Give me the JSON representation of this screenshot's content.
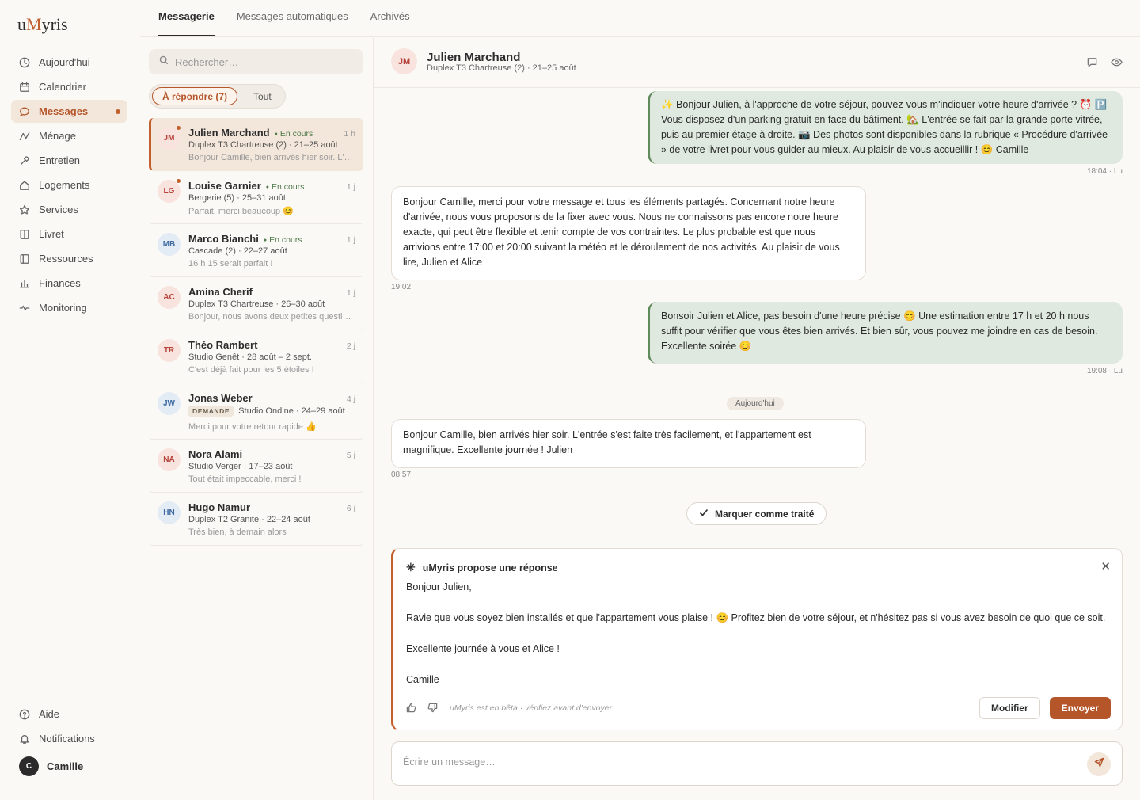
{
  "app": {
    "logo_prefix": "u",
    "logo_m": "M",
    "logo_suffix": "yris"
  },
  "sidebar": {
    "items": [
      {
        "label": "Aujourd'hui",
        "icon": "clock-icon"
      },
      {
        "label": "Calendrier",
        "icon": "calendar-icon"
      },
      {
        "label": "Messages",
        "icon": "chat-icon",
        "active": true,
        "unread_dot": true
      },
      {
        "label": "Ménage",
        "icon": "activity-icon"
      },
      {
        "label": "Entretien",
        "icon": "wrench-icon"
      },
      {
        "label": "Logements",
        "icon": "home-icon"
      },
      {
        "label": "Services",
        "icon": "star-icon"
      },
      {
        "label": "Livret",
        "icon": "book-icon"
      },
      {
        "label": "Ressources",
        "icon": "library-icon"
      },
      {
        "label": "Finances",
        "icon": "bar-chart-icon"
      },
      {
        "label": "Monitoring",
        "icon": "pulse-icon"
      }
    ],
    "bottom": [
      {
        "label": "Aide",
        "icon": "help-icon"
      },
      {
        "label": "Notifications",
        "icon": "bell-icon"
      }
    ],
    "user": {
      "initial": "C",
      "name": "Camille"
    }
  },
  "tabs": [
    {
      "label": "Messagerie",
      "active": true
    },
    {
      "label": "Messages automatiques"
    },
    {
      "label": "Archivés"
    }
  ],
  "list": {
    "search_placeholder": "Rechercher…",
    "filter_active": "À répondre (7)",
    "filter_all": "Tout",
    "conversations": [
      {
        "initials": "JM",
        "name": "Julien Marchand",
        "status": "En cours",
        "time": "1 h",
        "subtitle": "Duplex T3 Chartreuse (2) · 21–25 août",
        "preview": "Bonjour Camille, bien arrivés hier soir. L'entrée s'est faite très facilement",
        "unread": true
      },
      {
        "initials": "LG",
        "name": "Louise Garnier",
        "status": "En cours",
        "time": "1 j",
        "subtitle": "Bergerie (5) · 25–31 août",
        "preview": "Parfait, merci beaucoup 😊",
        "unread": true
      },
      {
        "initials": "MB",
        "name": "Marco Bianchi",
        "status": "En cours",
        "time": "1 j",
        "subtitle": "Cascade (2) · 22–27 août",
        "preview": "16 h 15 serait parfait !"
      },
      {
        "initials": "AC",
        "name": "Amina Cherif",
        "time": "1 j",
        "subtitle": "Duplex T3 Chartreuse · 26–30 août",
        "preview": "Bonjour, nous avons deux petites questions avant notre arrivée"
      },
      {
        "initials": "TR",
        "name": "Théo Rambert",
        "time": "2 j",
        "subtitle": "Studio Genêt · 28 août – 2 sept.",
        "preview": "C'est déjà fait pour les 5 étoiles !"
      },
      {
        "initials": "JW",
        "name": "Jonas Weber",
        "time": "4 j",
        "badge": "DEMANDE",
        "subtitle": "Studio Ondine · 24–29 août",
        "preview": "Merci pour votre retour rapide 👍"
      },
      {
        "initials": "NA",
        "name": "Nora Alami",
        "time": "5 j",
        "subtitle": "Studio Verger · 17–23 août",
        "preview": "Tout était impeccable, merci !"
      },
      {
        "initials": "HN",
        "name": "Hugo Namur",
        "time": "6 j",
        "subtitle": "Duplex T2 Granite · 22–24 août",
        "preview": "Très bien, à demain alors"
      }
    ]
  },
  "chat": {
    "initials": "JM",
    "name": "Julien Marchand",
    "subtitle": "Duplex T3 Chartreuse (2) · 21–25 août",
    "messages": [
      {
        "dir": "out",
        "text": "✨ Bonjour Julien, à l'approche de votre séjour, pouvez-vous m'indiquer votre heure d'arrivée ? ⏰ 🅿️ Vous disposez d'un parking gratuit en face du bâtiment. 🏡 L'entrée se fait par la grande porte vitrée, puis au premier étage à droite. 📷 Des photos sont disponibles dans la rubrique « Procédure d'arrivée » de votre livret pour vous guider au mieux. Au plaisir de vous accueillir ! 😊 Camille",
        "meta": "18:04 · Lu"
      },
      {
        "dir": "in",
        "text": "Bonjour Camille, merci pour votre message et tous les éléments partagés. Concernant notre heure d'arrivée, nous vous proposons de la fixer avec vous. Nous ne connaissons pas encore notre heure exacte, qui peut être flexible et tenir compte de vos contraintes. Le plus probable est que nous arrivions entre 17:00 et 20:00 suivant la météo et le déroulement de nos activités. Au plaisir de vous lire, Julien et Alice",
        "meta": "19:02"
      },
      {
        "dir": "out",
        "text": "Bonsoir Julien et Alice, pas besoin d'une heure précise 😊 Une estimation entre 17 h et 20 h nous suffit pour vérifier que vous êtes bien arrivés. Et bien sûr, vous pouvez me joindre en cas de besoin. Excellente soirée 😊",
        "meta": "19:08 · Lu"
      },
      {
        "dir": "in",
        "text": "Bonjour Camille, bien arrivés hier soir. L'entrée s'est faite très facilement, et l'appartement est magnifique. Excellente journée ! Julien",
        "meta": "08:57"
      }
    ],
    "day_separator": "Aujourd'hui",
    "mark_done": "Marquer comme traité",
    "proposal": {
      "title": "uMyris propose une réponse",
      "lines": [
        "Bonjour Julien,",
        "Ravie que vous soyez bien installés et que l'appartement vous plaise ! 😊 Profitez bien de votre séjour, et n'hésitez pas si vous avez besoin de quoi que ce soit.",
        "Excellente journée à vous et Alice !",
        "Camille"
      ],
      "beta_note": "uMyris est en bêta · vérifiez avant d'envoyer",
      "edit_label": "Modifier",
      "send_label": "Envoyer"
    },
    "composer_placeholder": "Écrire un message…"
  }
}
